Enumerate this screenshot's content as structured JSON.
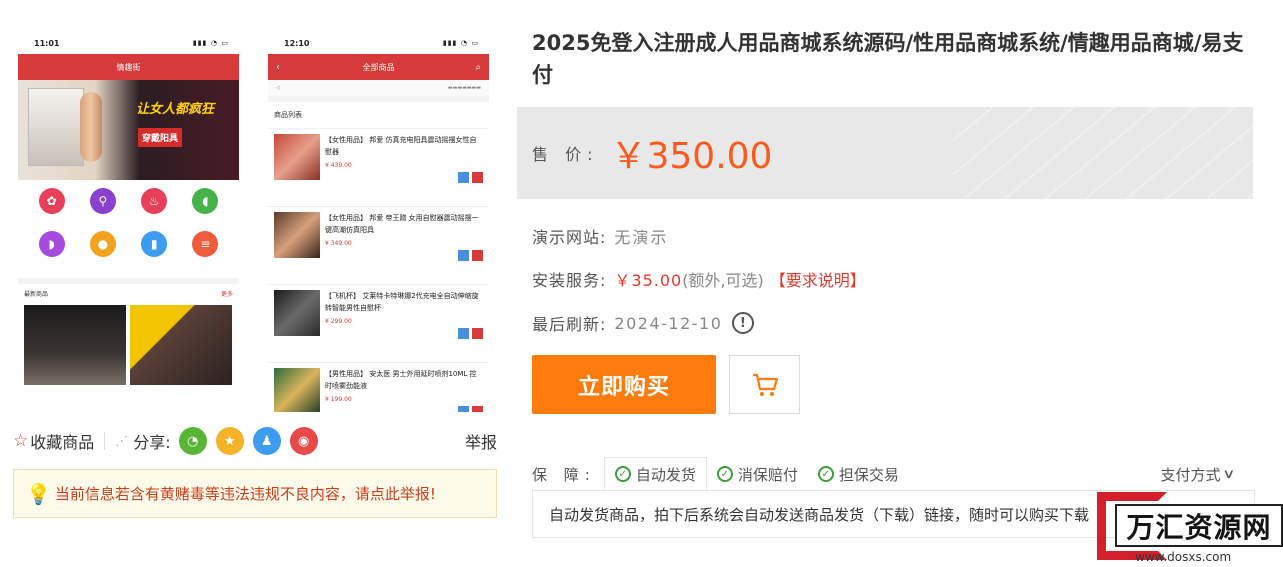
{
  "gallery": {
    "phone1": {
      "time": "11:01",
      "header": "情趣街",
      "banner_headline": "让女人都疯狂",
      "banner_badge": "穿戴阳具",
      "section_title": "最新商品",
      "section_more": "更多",
      "grid_icons": [
        {
          "icon": "flower-icon",
          "color": "#e8405a"
        },
        {
          "icon": "wand-icon",
          "color": "#8a3fcf"
        },
        {
          "icon": "heels-icon",
          "color": "#e8405a"
        },
        {
          "icon": "bottle-icon",
          "color": "#46b24a"
        },
        {
          "icon": "lingerie-icon",
          "color": "#a64be0"
        },
        {
          "icon": "drop-icon",
          "color": "#f2a41f"
        },
        {
          "icon": "cup-icon",
          "color": "#3d9bf0"
        },
        {
          "icon": "list-icon",
          "color": "#ef5b3b"
        }
      ]
    },
    "phone2": {
      "time": "12:10",
      "header": "全部商品",
      "list_title": "商品列表",
      "products": [
        {
          "name": "【女性用品】 邦爱 仿真充电阳具震动摇摆女性自慰器",
          "price": "¥ 439.00"
        },
        {
          "name": "【女性用品】 邦爱 帝王蹭 女用自慰器震动摇摆一键高潮仿真阳具",
          "price": "¥ 349.00"
        },
        {
          "name": "【飞机杯】 艾莱特卡特琳娜2代充电全自动伸缩旋转智能男性自慰杯",
          "price": "¥ 299.00"
        },
        {
          "name": "【男性用品】 安太医 男士外用延时喷剂10ML 控时喷雾劲能液",
          "price": "¥ 199.00"
        }
      ]
    }
  },
  "share": {
    "favorite_label": "收藏商品",
    "share_label": "分享:",
    "report_label": "举报"
  },
  "warning": {
    "text": "当前信息若含有黄赌毒等违法违规不良内容，请点此举报!"
  },
  "product": {
    "title": "2025免登入注册成人用品商城系统源码/性用品商城系统/情趣用品商城/易支付",
    "price_label": "售 价:",
    "price": "￥350.00",
    "demo_label": "演示网站:",
    "demo_value": "无演示",
    "install_label": "安装服务:",
    "install_price": "￥35.00",
    "install_note": "(额外,可选)",
    "install_req": "【要求说明】",
    "refresh_label": "最后刷新:",
    "refresh_date": "2024-12-10",
    "buy_label": "立即购买"
  },
  "guarantee": {
    "label": "保 障:",
    "tabs": [
      "自动发货",
      "消保赔付",
      "担保交易"
    ],
    "pay_method": "支付方式",
    "desc": "自动发货商品，拍下后系统会自动发送商品发货（下载）链接，随时可以购买下载"
  },
  "watermark": {
    "name": "万汇资源网",
    "url": "www.dosxs.com"
  },
  "colors": {
    "accent_orange": "#ff7b0e",
    "price_orange": "#ff5a1e",
    "alert_red": "#e23b2e",
    "check_green": "#3b9c3b"
  }
}
